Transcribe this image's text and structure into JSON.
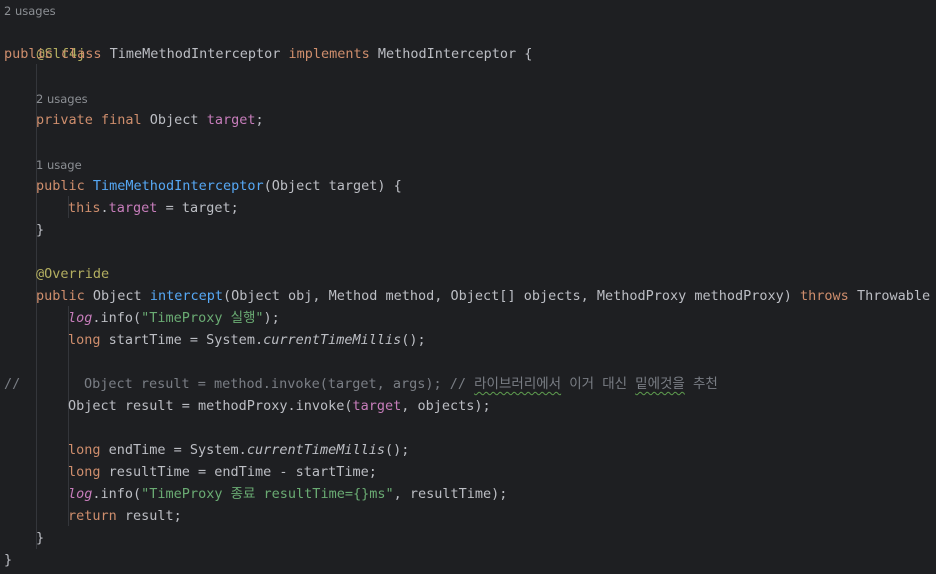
{
  "hints": {
    "class_usages": "2 usages",
    "field_usages": "2 usages",
    "ctor_usages": "1 usage"
  },
  "code": {
    "l_annot": "@Slf4j",
    "l_class_kw": "public class ",
    "l_class_name": "TimeMethodInterceptor",
    "l_class_impl": " implements ",
    "l_class_iface": "MethodInterceptor {",
    "l_field_kw": "private final ",
    "l_field_type": "Object ",
    "l_field_name": "target",
    "l_field_end": ";",
    "l_ctor_kw": "public ",
    "l_ctor_name": "TimeMethodInterceptor",
    "l_ctor_params": "(Object target) {",
    "l_this_kw": "this",
    "l_this_dot": ".",
    "l_this_field": "target",
    "l_this_rest": " = target;",
    "l_ctor_close": "}",
    "l_override": "@Override",
    "l_m_kw": "public ",
    "l_m_type": "Object ",
    "l_m_name": "intercept",
    "l_m_params": "(Object obj, Method method, Object[] objects, MethodProxy methodProxy) ",
    "l_m_throws": "throws",
    "l_m_exc": " Throwable {",
    "l_log1_obj": "log",
    "l_log1_call": ".info(",
    "l_log1_str": "\"TimeProxy 실행\"",
    "l_log1_end": ");",
    "l_start_kw": "long",
    "l_start_a": " startTime = System.",
    "l_start_m": "currentTimeMillis",
    "l_start_b": "();",
    "l_cm_prefix": "//",
    "l_cm_code": "Object result = method.invoke(target, args); // ",
    "l_cm_w1": "라이브러리에서",
    "l_cm_mid": " 이거 대신 ",
    "l_cm_w2": "밑에것을",
    "l_cm_end": " 추천",
    "l_res_a": "Object result = methodProxy.invoke(",
    "l_res_field": "target",
    "l_res_b": ", objects);",
    "l_end_kw": "long",
    "l_end_a": " endTime = System.",
    "l_end_m": "currentTimeMillis",
    "l_end_b": "();",
    "l_rt_kw": "long",
    "l_rt_a": " resultTime = endTime - startTime;",
    "l_log2_obj": "log",
    "l_log2_call": ".info(",
    "l_log2_str": "\"TimeProxy 종료 resultTime={}ms\"",
    "l_log2_end": ", resultTime);",
    "l_ret_kw": "return",
    "l_ret_a": " result;",
    "l_m_close": "}",
    "l_class_close": "}"
  }
}
